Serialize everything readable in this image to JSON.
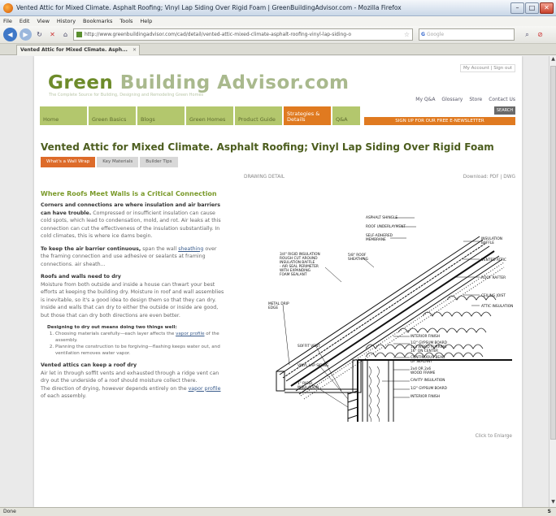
{
  "window": {
    "title": "Vented Attic for Mixed Climate. Asphalt Roofing; Vinyl Lap Siding Over Rigid Foam | GreenBuildingAdvisor.com - Mozilla Firefox",
    "minimize": "–",
    "maximize": "□",
    "close": "✕"
  },
  "menu": [
    "File",
    "Edit",
    "View",
    "History",
    "Bookmarks",
    "Tools",
    "Help"
  ],
  "browser": {
    "url": "http://www.greenbuildingadvisor.com/cad/detail/vented-attic-mixed-climate-asphalt-roofing-vinyl-lap-siding-o",
    "search_placeholder": "Google",
    "tab_title": "Vented Attic for Mixed Climate. Asph...",
    "status": "Done"
  },
  "site": {
    "top_links": "My Account | Sign out",
    "logo_green": "Green",
    "logo_rest": " Building Advisor.com",
    "tagline": "The Complete Source for Building, Designing and Remodeling Green Homes",
    "utility": [
      "My Q&A",
      "Glossary",
      "Store",
      "Contact Us"
    ],
    "nav": [
      "Home",
      "Green Basics",
      "Blogs",
      "Green Homes",
      "Product Guide",
      "Strategies & Details",
      "Q&A"
    ],
    "search_button": "SEARCH",
    "newsletter": "SIGN UP FOR OUR FREE E-NEWSLETTER"
  },
  "article": {
    "title": "Vented Attic for Mixed Climate. Asphalt Roofing; Vinyl Lap Siding Over Rigid Foam",
    "tabs": [
      "What's a Wall Wrap",
      "Key Materials",
      "Builder Tips"
    ],
    "section_head": "Where Roofs Meet Walls is a Critical Connection",
    "p1_lead": "Corners and connections are where insulation and air barriers can have trouble.",
    "p1_rest": " Compressed or insufficient insulation can cause cold spots, which lead to condensation, mold, and rot. Air leaks at this connection can cut the effectiveness of the insulation substantially. In cold climates, this is where ice dams begin.",
    "p2_lead": "To keep the air barrier continuous,",
    "p2_mid": " span the wall ",
    "p2_link": "sheathing",
    "p2_rest": " over the framing connection and use adhesive or sealants at framing connections. air sheath...",
    "h3": "Roofs and walls need to dry",
    "p3": "Moisture from both outside and inside a house can thwart your best efforts at keeping the building dry. Moisture in roof and wall assemblies is inevitable, so it's a good idea to design them so that they can dry. Inside and walls that can dry to either the outside or inside are good, but those that can dry both directions are even better.",
    "callout_head": "Designing to dry out means doing two things well:",
    "callout_1a": "Choosing materials carefully—each layer affects the ",
    "callout_1_link": "vapor profile",
    "callout_1b": " of the assembly.",
    "callout_2": "Planning the construction to be forgiving—flashing keeps water out, and ventilation removes water vapor.",
    "h4": "Vented attics can keep a roof dry",
    "p4": "Air let in through soffit vents and exhausted through a ridge vent can dry out the underside of a roof should moisture collect there.",
    "p5a": "The direction of drying, however depends entirely on the ",
    "p5_link": "vapor profile",
    "p5b": " of each assembly."
  },
  "drawing": {
    "label": "DRAWING DETAIL",
    "download": "Download: PDF | DWG",
    "click_enlarge": "Click to Enlarge",
    "labels": {
      "asphalt_shingle": "ASPHALT SHINGLE",
      "roof_underlayment": "ROOF UNDERLAYMENT",
      "self_adhered_1": "SELF-ADHERED",
      "self_adhered_2": "MEMBRANE",
      "rigid_1": "3/4\" RIGID INSULATION",
      "rigid_2": "ROUGH CUT AROUND",
      "rigid_3": "INSULATION BAFFLE",
      "rigid_4": "- AIR SEAL PERIMETER",
      "rigid_5": "WITH EXPANDING",
      "rigid_6": "FOAM SEALANT",
      "roof_sheathing_1": "5/8\" ROOF",
      "roof_sheathing_2": "SHEATHING",
      "baffle_1": "INSULATION",
      "baffle_2": "BAFFLE",
      "vented_attic": "VENTED ATTIC",
      "roof_rafter": "ROOF RAFTER",
      "metal_drip_1": "METAL DRIP",
      "metal_drip_2": "EDGE",
      "ceiling_joist": "CEILING JOIST",
      "attic_insulation": "ATTIC INSULATION",
      "interior_finish": "INTERIOR FINISH",
      "gypsum_1": "1/2\" GYPSUM BOARD",
      "gypsum_2": "1x3 WOOD FURRING",
      "gypsum_3": "16\" ON CENTER",
      "bead_1": "CONTINUOUS BEAD",
      "bead_2": "OF SEALANT",
      "stud_1": "2x4 OR 2x6",
      "stud_2": "WOOD FRAME",
      "soffit_vent": "SOFFIT VENT",
      "cavity_insulation": "CAVITY INSULATION",
      "vinyl_siding": "VINYL LAP SIDING",
      "gypsum_b": "1/2\" GYPSUM BOARD",
      "rigid_ins_1": "1\" RIGID",
      "rigid_ins_2": "INSULATION",
      "interior_finish_b": "INTERIOR FINISH"
    }
  },
  "colors": {
    "nav_green": "#b3c76d",
    "accent_orange": "#e07a20",
    "title_green": "#4c5d1e",
    "section_green": "#7a9a2a"
  }
}
